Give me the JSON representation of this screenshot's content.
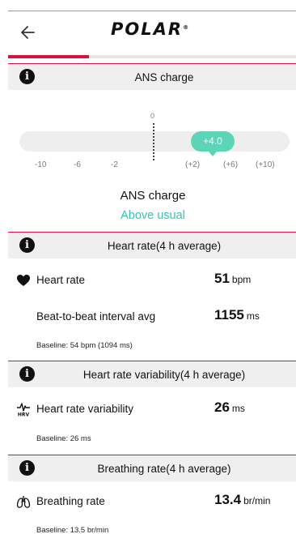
{
  "header": {
    "logo_text": "POLAR",
    "logo_mark": "®"
  },
  "progress": {
    "fraction": 0.28
  },
  "ans": {
    "section_title": "ANS charge",
    "zero_label": "0",
    "bubble_value": "+4.0",
    "ticks": [
      "-10",
      "-6",
      "-2",
      "(+2)",
      "(+6)",
      "(+10)"
    ],
    "label": "ANS charge",
    "status": "Above usual",
    "status_color": "#2ec8b1"
  },
  "heart": {
    "section_title": "Heart rate(4 h average)",
    "hr_label": "Heart rate",
    "hr_value": "51",
    "hr_unit": "bpm",
    "ibi_label": "Beat-to-beat interval avg",
    "ibi_value": "1155",
    "ibi_unit": "ms",
    "baseline": "Baseline: 54 bpm (1094 ms)"
  },
  "hrv": {
    "section_title": "Heart rate variability(4 h average)",
    "icon_text": "HRV",
    "label": "Heart rate variability",
    "value": "26",
    "unit": "ms",
    "baseline": "Baseline: 26 ms"
  },
  "breathing": {
    "section_title": "Breathing rate(4 h average)",
    "label": "Breathing rate",
    "value": "13.4",
    "unit": "br/min",
    "baseline": "Baseline: 13.5 br/min"
  },
  "colors": {
    "accent": "#d3143c",
    "gauge": "#5bd5b5",
    "section_bg": "#efefef"
  }
}
